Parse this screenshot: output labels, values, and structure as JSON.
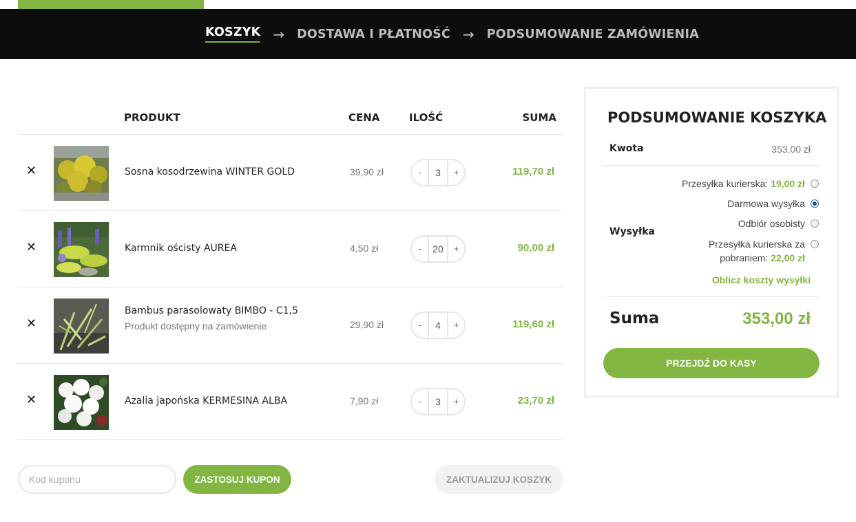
{
  "steps": {
    "items": [
      "KOSZYK",
      "DOSTAWA I PŁATNOŚĆ",
      "PODSUMOWANIE ZAMÓWIENIA"
    ],
    "active_index": 0,
    "arrow": "→"
  },
  "cart": {
    "headers": {
      "product": "PRODUKT",
      "price": "CENA",
      "qty": "ILOŚĆ",
      "total": "SUMA"
    },
    "remove_glyph": "✕",
    "minus": "-",
    "plus": "+",
    "items": [
      {
        "name": "Sosna kosodrzewina WINTER GOLD",
        "note": "",
        "price": "39,90 zł",
        "qty": "3",
        "total": "119,70 zł"
      },
      {
        "name": "Karmnik ościsty AUREA",
        "note": "",
        "price": "4,50 zł",
        "qty": "20",
        "total": "90,00 zł"
      },
      {
        "name": "Bambus parasolowaty BIMBO - C1,5",
        "note": "Produkt dostępny na zamówienie",
        "price": "29,90 zł",
        "qty": "4",
        "total": "119,60 zł"
      },
      {
        "name": "Azalia japońska KERMESINA ALBA",
        "note": "",
        "price": "7,90 zł",
        "qty": "3",
        "total": "23,70 zł"
      }
    ]
  },
  "coupon": {
    "placeholder": "Kod kuponu",
    "apply_label": "ZASTOSUJ KUPON",
    "update_label": "ZAKTUALIZUJ KOSZYK"
  },
  "summary": {
    "title": "PODSUMOWANIE KOSZYKA",
    "amount_label": "Kwota",
    "amount_value": "353,00 zł",
    "shipping_label": "Wysyłka",
    "shipping_options": [
      {
        "label": "Przesyłka kurierska:",
        "price": "19,00 zł",
        "checked": false
      },
      {
        "label": "Darmowa wysyłka",
        "price": "",
        "checked": true
      },
      {
        "label": "Odbiór osobisty",
        "price": "",
        "checked": false
      },
      {
        "label_line1": "Przesyłka kurierska za",
        "label_line2": "pobraniem:",
        "price": "22,00 zł",
        "checked": false
      }
    ],
    "calc_link": "Oblicz koszty wysyłki",
    "total_label": "Suma",
    "total_value": "353,00 zł",
    "checkout_label": "PRZEJDŹ DO KASY"
  },
  "colors": {
    "accent": "#82b541",
    "header_bg": "#0d0d0d"
  }
}
